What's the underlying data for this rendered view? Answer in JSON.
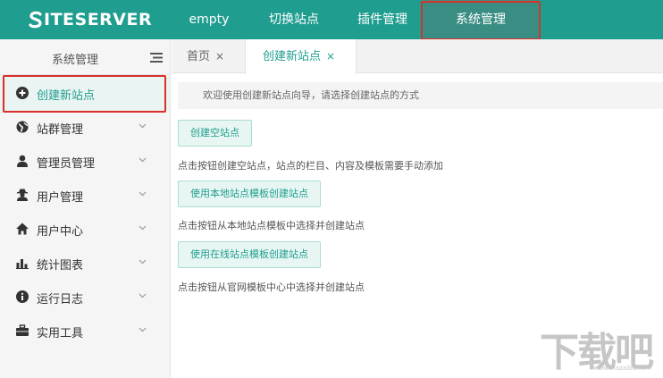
{
  "brand": {
    "logo_text": "ITESERVER",
    "logo_letter": "S"
  },
  "topnav": {
    "items": [
      {
        "label": "empty"
      },
      {
        "label": "切换站点"
      },
      {
        "label": "插件管理"
      },
      {
        "label": "系统管理",
        "active": true
      }
    ]
  },
  "sidebar": {
    "title": "系统管理",
    "items": [
      {
        "label": "创建新站点",
        "icon": "plus-circle-icon",
        "active": true
      },
      {
        "label": "站群管理",
        "icon": "globe-icon"
      },
      {
        "label": "管理员管理",
        "icon": "user-icon"
      },
      {
        "label": "用户管理",
        "icon": "user-secret-icon"
      },
      {
        "label": "用户中心",
        "icon": "home-icon"
      },
      {
        "label": "统计图表",
        "icon": "bar-chart-icon"
      },
      {
        "label": "运行日志",
        "icon": "info-circle-icon"
      },
      {
        "label": "实用工具",
        "icon": "briefcase-icon"
      }
    ]
  },
  "tabs": [
    {
      "label": "首页",
      "close": "×"
    },
    {
      "label": "创建新站点",
      "close": "×",
      "active": true
    }
  ],
  "content": {
    "welcome": "欢迎使用创建新站点向导，请选择创建站点的方式",
    "options": [
      {
        "button": "创建空站点",
        "desc": "点击按钮创建空站点，站点的栏目、内容及模板需要手动添加"
      },
      {
        "button": "使用本地站点模板创建站点",
        "desc": "点击按钮从本地站点模板中选择并创建站点"
      },
      {
        "button": "使用在线站点模板创建站点",
        "desc": "点击按钮从官网模板中心中选择并创建站点"
      }
    ]
  },
  "watermark": {
    "text": "下载吧",
    "url": "www.xiazaiba.com"
  },
  "colors": {
    "accent": "#1f9e8f",
    "highlight_box": "#d9302a"
  }
}
